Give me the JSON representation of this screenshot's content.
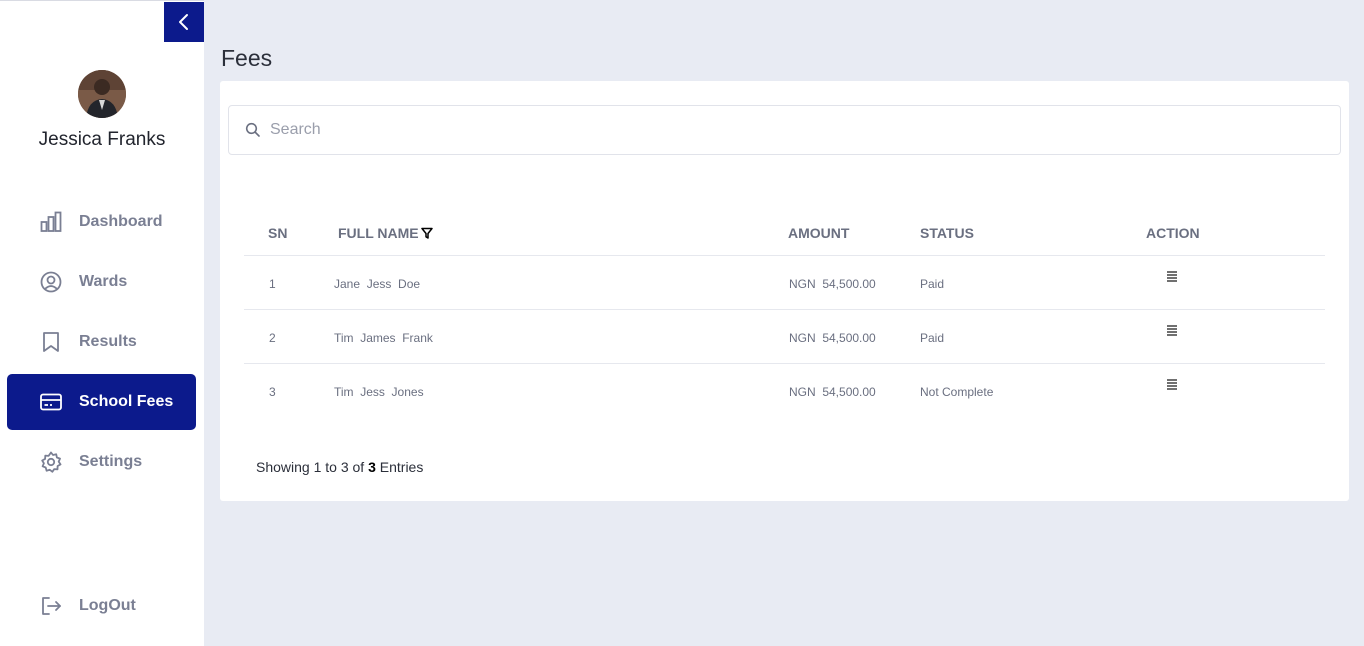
{
  "sidebar": {
    "user_name": "Jessica Franks",
    "nav": [
      {
        "label": "Dashboard",
        "icon": "bar-chart-icon"
      },
      {
        "label": "Wards",
        "icon": "user-circle-icon"
      },
      {
        "label": "Results",
        "icon": "bookmark-icon"
      },
      {
        "label": "School Fees",
        "icon": "credit-card-icon",
        "active": true
      },
      {
        "label": "Settings",
        "icon": "gear-icon"
      }
    ],
    "logout_label": "LogOut"
  },
  "page": {
    "title": "Fees"
  },
  "search": {
    "placeholder": "Search"
  },
  "table": {
    "headers": {
      "sn": "SN",
      "full_name": "FULL NAME",
      "amount": "AMOUNT",
      "status": "STATUS",
      "action": "ACTION"
    },
    "rows": [
      {
        "sn": "1",
        "name": "Jane  Jess  Doe",
        "amount": "NGN  54,500.00",
        "status": "Paid"
      },
      {
        "sn": "2",
        "name": "Tim  James  Frank",
        "amount": "NGN  54,500.00",
        "status": "Paid"
      },
      {
        "sn": "3",
        "name": "Tim  Jess  Jones",
        "amount": "NGN  54,500.00",
        "status": "Not Complete"
      }
    ]
  },
  "footer": {
    "prefix": "Showing 1 to 3 of ",
    "total": "3",
    "suffix": " Entries"
  },
  "colors": {
    "accent": "#0c1a8c",
    "background": "#e8ebf3"
  }
}
